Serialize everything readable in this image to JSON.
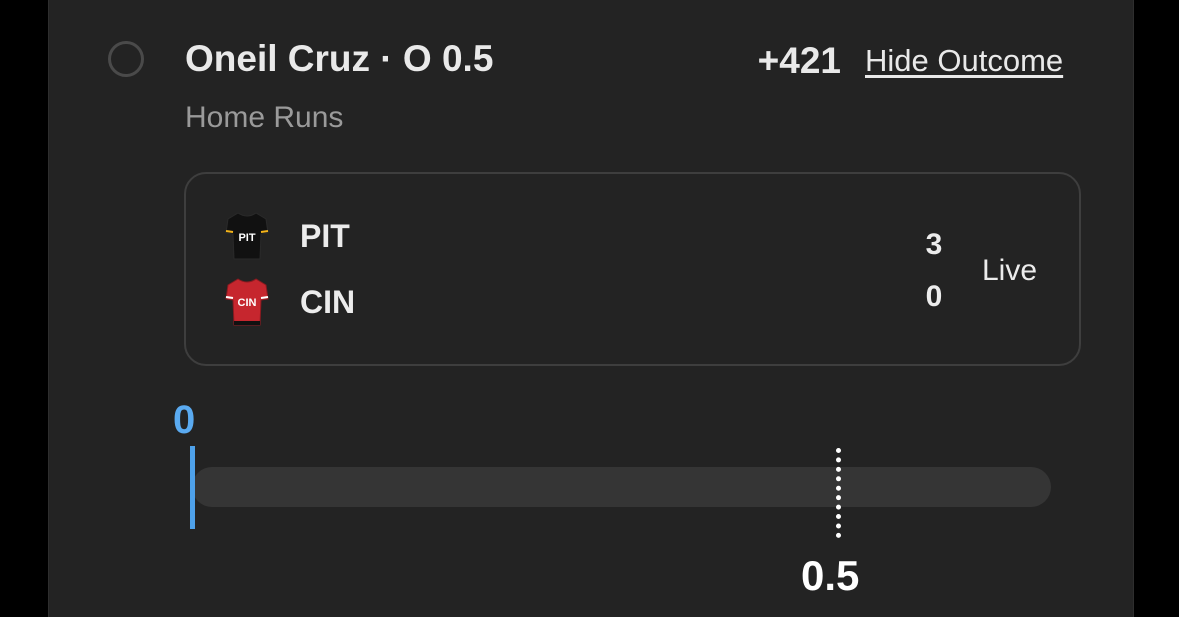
{
  "bet": {
    "title": "Oneil Cruz · O 0.5",
    "odds": "+421",
    "hide_label": "Hide Outcome",
    "market": "Home Runs"
  },
  "game": {
    "teams": [
      {
        "abbr": "PIT",
        "score": "3",
        "jersey_icon": "pirates-jersey-icon",
        "jersey_color": "#111111",
        "jersey_accent": "#f4b41a"
      },
      {
        "abbr": "CIN",
        "score": "0",
        "jersey_icon": "reds-jersey-icon",
        "jersey_color": "#c6262e",
        "jersey_accent": "#ffffff"
      }
    ],
    "status": "Live"
  },
  "progress": {
    "current_value": 0,
    "current_label": "0",
    "threshold_value": 0.5,
    "threshold_label": "0.5",
    "current_color": "#4ea1ea"
  },
  "colors": {
    "card_bg": "#232323",
    "page_bg": "#000000",
    "text_primary": "#e9e9e9",
    "text_secondary": "#9a9a9a"
  }
}
